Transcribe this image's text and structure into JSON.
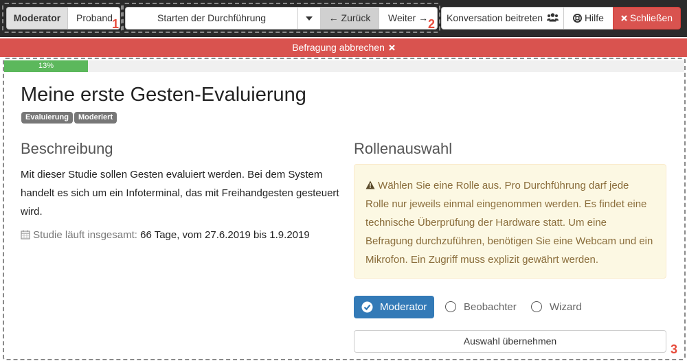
{
  "navbar": {
    "role_moderator": "Moderator",
    "role_proband": "Proband",
    "group1_number": "1",
    "start_select": "Starten der Durchführung",
    "back": "← Zurück",
    "next": "Weiter →",
    "group2_number": "2",
    "join": "Konversation beitreten",
    "help": "Hilfe",
    "close": "Schließen"
  },
  "abort": {
    "label": "Befragung abbrechen"
  },
  "progress": {
    "percent": 13,
    "label": "13%"
  },
  "study": {
    "title": "Meine erste Gesten-Evaluierung",
    "badges": [
      "Evaluierung",
      "Moderiert"
    ],
    "description_heading": "Beschreibung",
    "description": "Mit dieser Studie sollen Gesten evaluiert werden. Bei dem System handelt es sich um ein Infoterminal, das mit Freihandgesten gesteuert wird.",
    "duration_label": "Studie läuft insgesamt:",
    "duration_value": "66 Tage, vom 27.6.2019 bis 1.9.2019"
  },
  "roles": {
    "heading": "Rollenauswahl",
    "alert": "Wählen Sie eine Rolle aus. Pro Durchführung darf jede Rolle nur jeweils einmal eingenommen werden. Es findet eine technische Überprüfung der Hardware statt. Um eine Befragung durchzuführen, benötigen Sie eine Webcam und ein Mikrofon. Ein Zugriff muss explizit gewährt werden.",
    "options": [
      "Moderator",
      "Beobachter",
      "Wizard"
    ],
    "selected": "Moderator",
    "apply": "Auswahl übernehmen"
  },
  "annotation": {
    "group3_number": "3"
  },
  "colors": {
    "navbar": "#2b2b2b",
    "danger": "#d9534f",
    "success": "#5cb85c",
    "primary": "#337ab7",
    "warning_bg": "#fcf8e3",
    "warning_text": "#8a6d3b",
    "annotation": "#e74c3c"
  }
}
